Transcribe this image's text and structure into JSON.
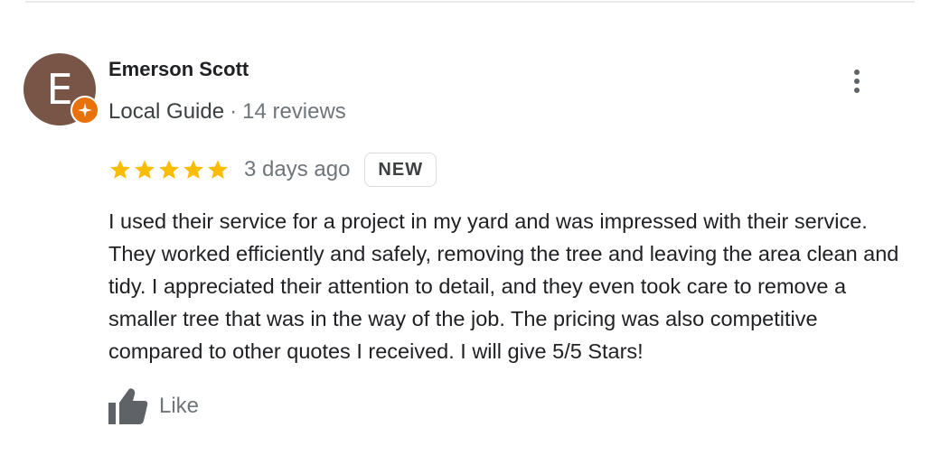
{
  "reviewer": {
    "avatar_initial": "E",
    "avatar_color": "#795548",
    "badge_icon": "local-guide-star-icon",
    "badge_color": "#e8710a",
    "name": "Emerson Scott",
    "guide_label": "Local Guide",
    "separator": "·",
    "review_count": "14 reviews"
  },
  "menu": {
    "icon": "more-vertical-icon"
  },
  "rating": {
    "stars": 5,
    "max_stars": 5,
    "star_color": "#fbbc04",
    "date": "3 days ago",
    "badge": "NEW"
  },
  "review": {
    "text": "I used their service for a project in my yard and was impressed with their service. They worked efficiently and safely, removing the tree and leaving the area clean and tidy. I appreciated their attention to detail, and they even took care to remove a smaller tree that was in the way of the job. The pricing was also competitive compared to other quotes I received. I will give 5/5 Stars!"
  },
  "actions": {
    "like_icon": "thumbs-up-icon",
    "like_label": "Like"
  }
}
